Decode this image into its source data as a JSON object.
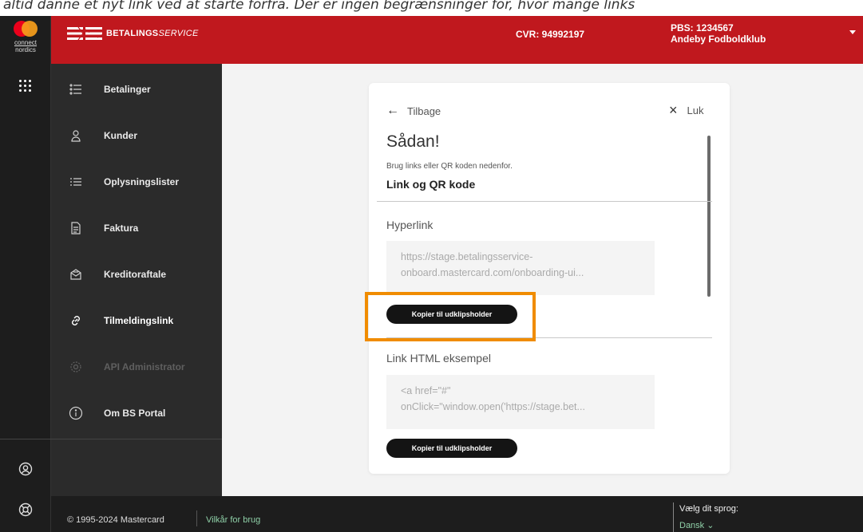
{
  "banner_text": "altid danne et nyt link ved at starte forfra. Der er ingen begrænsninger for, hvor mange links",
  "rail": {
    "brand_line1": "connect",
    "brand_line2": "nordics",
    "icons": [
      "apps-grid-icon",
      "user-circle-icon",
      "help-lifebuoy-icon"
    ]
  },
  "topbar": {
    "brand": "BETALINGSSERVICE",
    "brand_bold": "BETALINGS",
    "brand_light": "SERVICE",
    "cvr": "CVR: 94992197",
    "pbs": "PBS: 1234567",
    "org": "Andeby Fodboldklub",
    "colors": {
      "bar": "#c0181e"
    }
  },
  "sidebar": {
    "items": [
      {
        "label": "Betalinger",
        "icon": "list-icon",
        "state": "normal"
      },
      {
        "label": "Kunder",
        "icon": "person-icon",
        "state": "normal"
      },
      {
        "label": "Oplysningslister",
        "icon": "list-bullets-icon",
        "state": "normal"
      },
      {
        "label": "Faktura",
        "icon": "document-icon",
        "state": "normal"
      },
      {
        "label": "Kreditoraftale",
        "icon": "envelope-icon",
        "state": "normal"
      },
      {
        "label": "Tilmeldingslink",
        "icon": "link-icon",
        "state": "active"
      },
      {
        "label": "API Administrator",
        "icon": "gear-icon",
        "state": "disabled"
      },
      {
        "label": "Om BS Portal",
        "icon": "info-icon",
        "state": "normal"
      }
    ]
  },
  "card": {
    "back_label": "Tilbage",
    "close_label": "Luk",
    "title": "Sådan!",
    "subtitle": "Brug links eller QR koden nedenfor.",
    "tab_heading": "Link og QR kode",
    "hyperlink": {
      "label": "Hyperlink",
      "line1": "https://stage.betalingsservice-",
      "line2": "onboard.mastercard.com/onboarding-ui...",
      "button": "Kopier til udklipsholder"
    },
    "html_example": {
      "label": "Link HTML eksempel",
      "line1": "<a href=\"#\"",
      "line2": "onClick=\"window.open('https://stage.bet...",
      "button": "Kopier til udklipsholder"
    },
    "highlight_color": "#f08c00"
  },
  "footer": {
    "copyright": "© 1995-2024 Mastercard",
    "terms": "Vilkår for brug",
    "lang_title": "Vælg dit sprog:",
    "lang_value": "Dansk ⌄"
  }
}
